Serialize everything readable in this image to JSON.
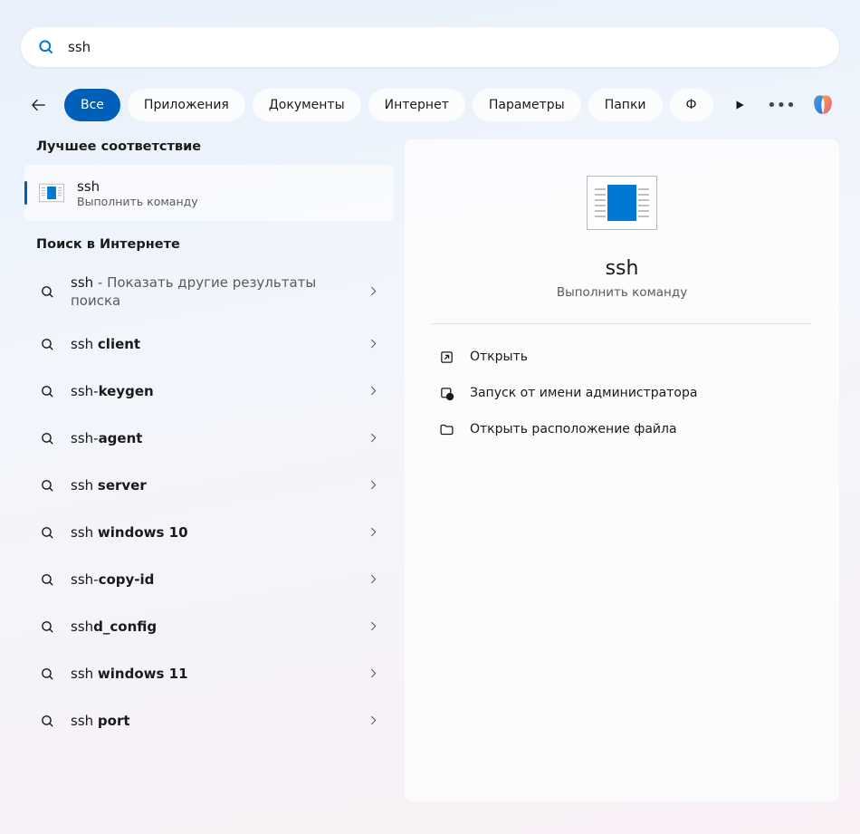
{
  "search": {
    "value": "ssh"
  },
  "filters": {
    "items": [
      {
        "label": "Все",
        "active": true
      },
      {
        "label": "Приложения",
        "active": false
      },
      {
        "label": "Документы",
        "active": false
      },
      {
        "label": "Интернет",
        "active": false
      },
      {
        "label": "Параметры",
        "active": false
      },
      {
        "label": "Папки",
        "active": false
      },
      {
        "label": "Ф",
        "active": false
      }
    ]
  },
  "sections": {
    "best_match_header": "Лучшее соответствие",
    "web_header": "Поиск в Интернете"
  },
  "best_match": {
    "title": "ssh",
    "subtitle": "Выполнить команду"
  },
  "web_results": [
    {
      "prefix": "ssh",
      "bold": "",
      "hint": " - Показать другие результаты",
      "hint_line2": "поиска",
      "tall": true
    },
    {
      "prefix": "ssh ",
      "bold": "client"
    },
    {
      "prefix": "ssh-",
      "bold": "keygen"
    },
    {
      "prefix": "ssh-",
      "bold": "agent"
    },
    {
      "prefix": "ssh ",
      "bold": "server"
    },
    {
      "prefix": "ssh ",
      "bold": "windows 10"
    },
    {
      "prefix": "ssh-",
      "bold": "copy-id"
    },
    {
      "prefix": "ssh",
      "bold": "d_config"
    },
    {
      "prefix": "ssh ",
      "bold": "windows 11"
    },
    {
      "prefix": "ssh ",
      "bold": "port"
    }
  ],
  "preview": {
    "title": "ssh",
    "subtitle": "Выполнить команду",
    "actions": [
      {
        "icon": "open",
        "label": "Открыть"
      },
      {
        "icon": "admin",
        "label": "Запуск от имени администратора"
      },
      {
        "icon": "folder",
        "label": "Открыть расположение файла"
      }
    ]
  }
}
